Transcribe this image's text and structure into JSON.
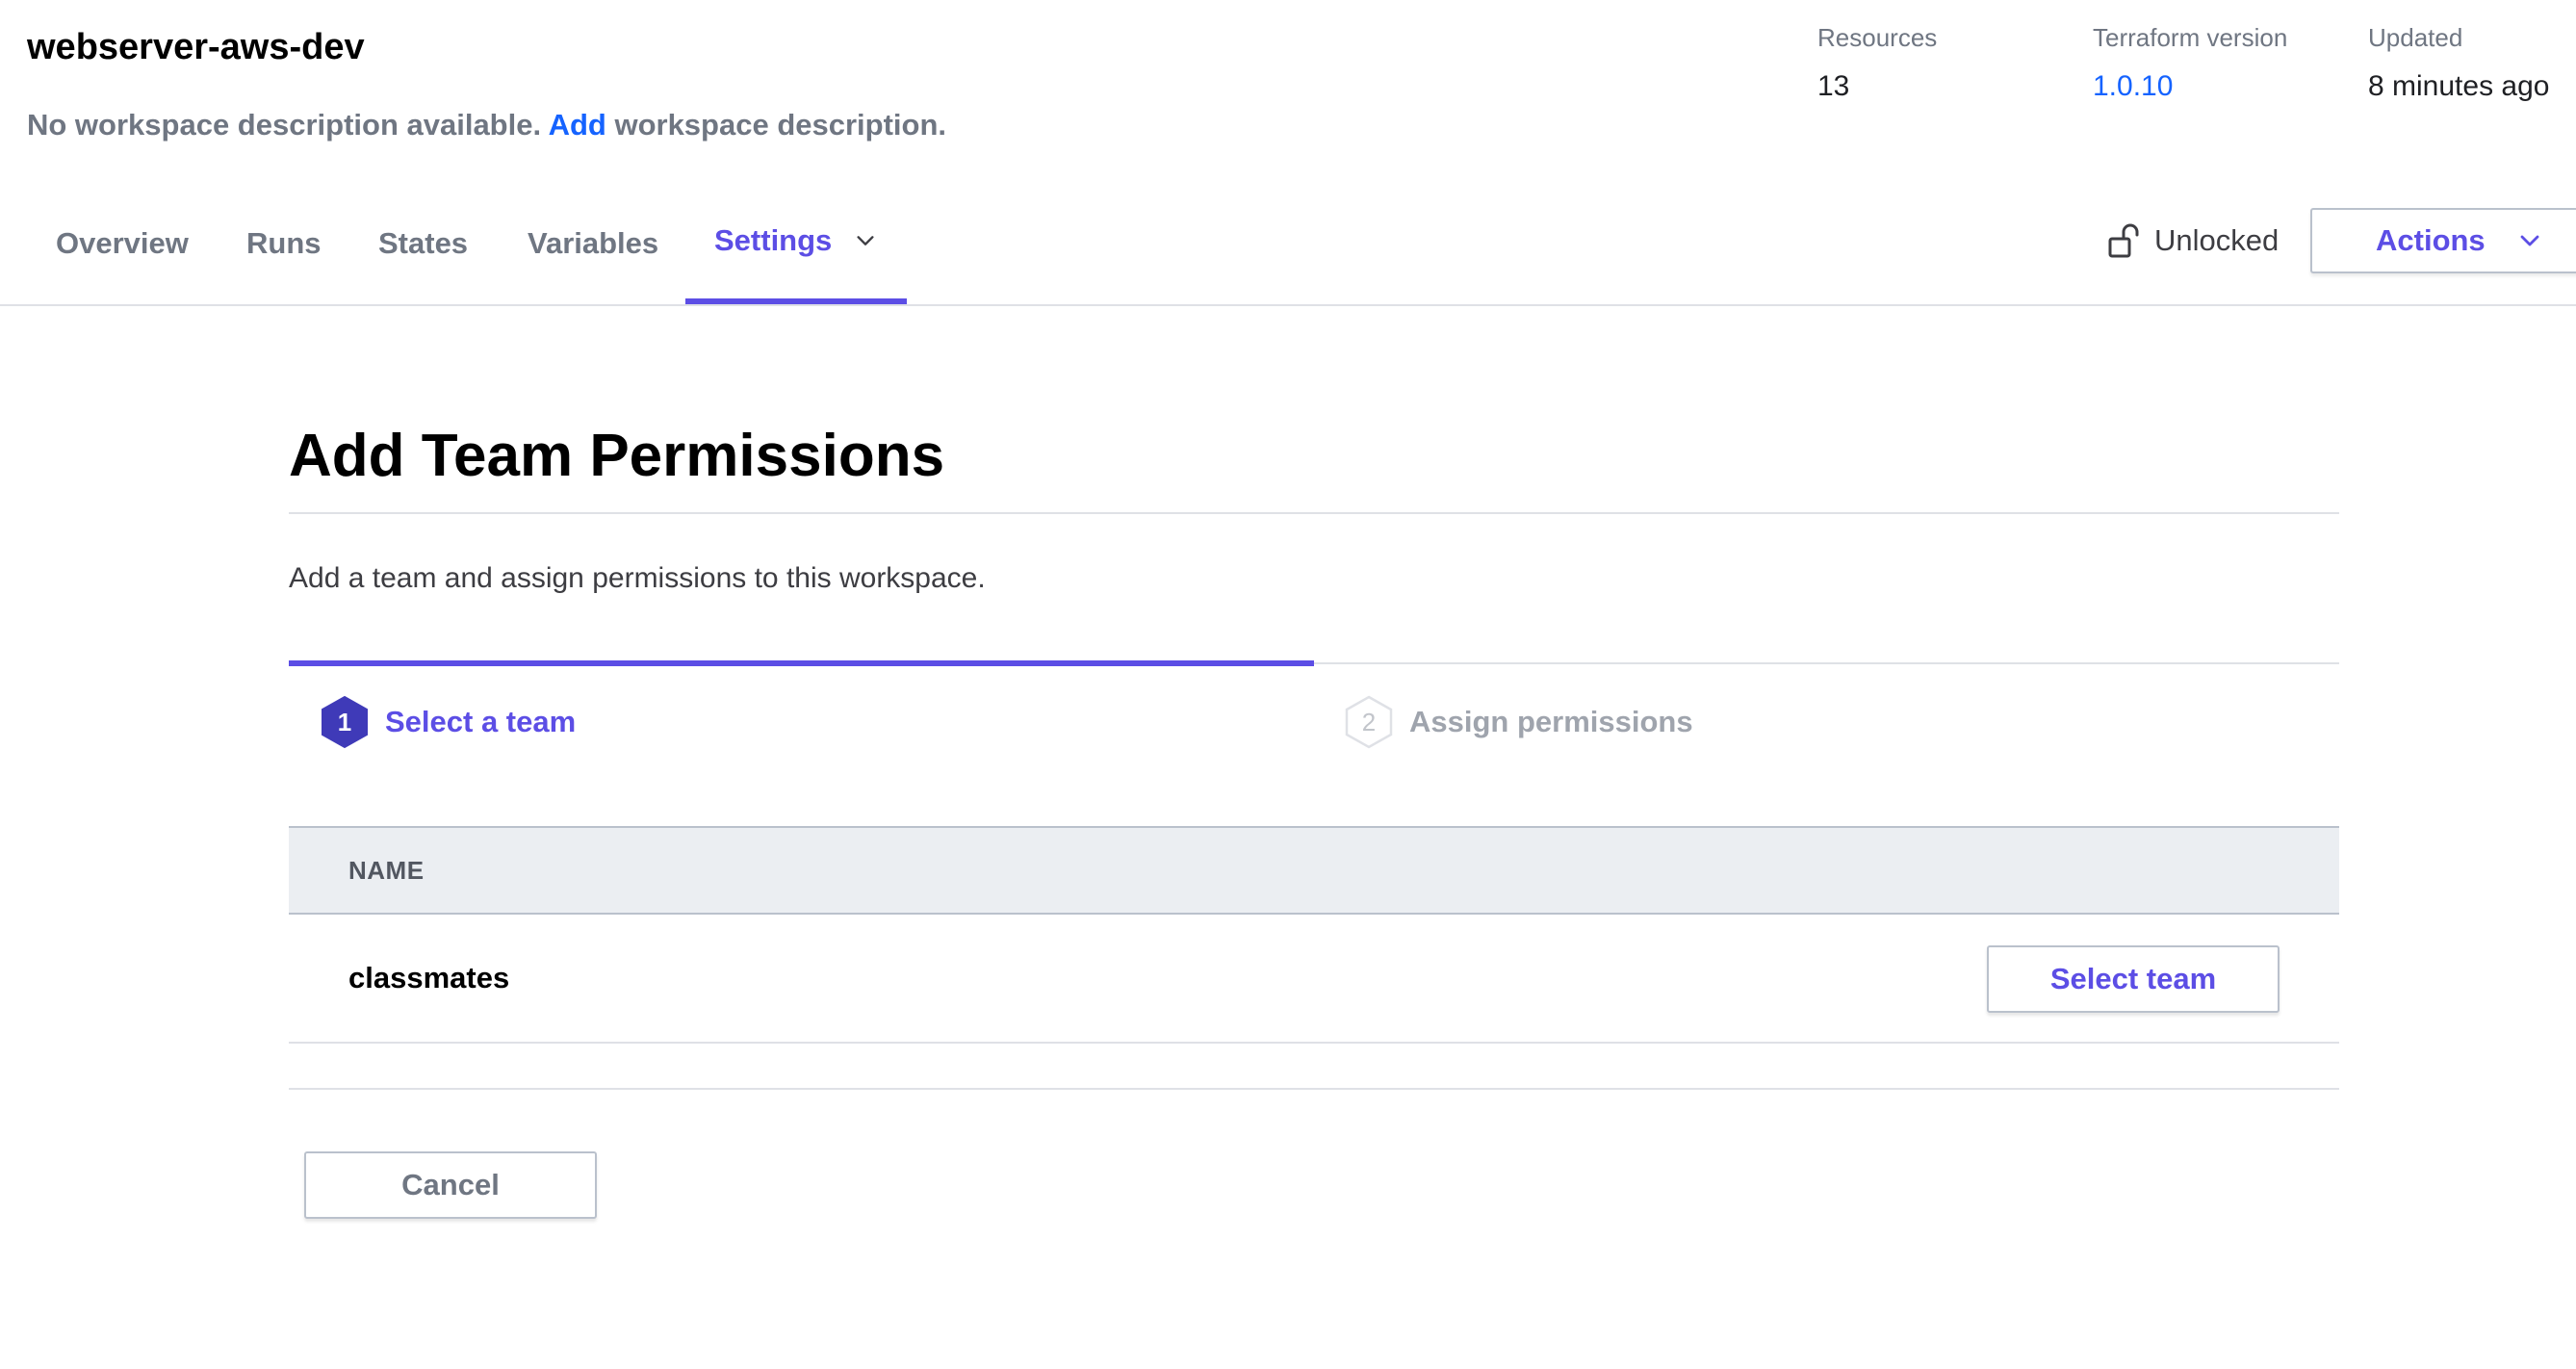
{
  "workspace": {
    "title": "webserver-aws-dev",
    "description_prefix": "No workspace description available.",
    "description_link": "Add",
    "description_suffix": "workspace description."
  },
  "meta": {
    "resources": {
      "label": "Resources",
      "value": "13"
    },
    "terraform_version": {
      "label": "Terraform version",
      "value": "1.0.10"
    },
    "updated": {
      "label": "Updated",
      "value": "8 minutes ago"
    }
  },
  "tabs": [
    {
      "label": "Overview",
      "active": false
    },
    {
      "label": "Runs",
      "active": false
    },
    {
      "label": "States",
      "active": false
    },
    {
      "label": "Variables",
      "active": false
    },
    {
      "label": "Settings",
      "active": true,
      "icon": "chevron-down-icon"
    }
  ],
  "lock_status": {
    "label": "Unlocked",
    "icon": "unlock-icon"
  },
  "actions_button": {
    "label": "Actions",
    "icon": "chevron-down-icon"
  },
  "page": {
    "title": "Add Team Permissions",
    "intro": "Add a team and assign permissions to this workspace."
  },
  "steps": [
    {
      "number": "1",
      "label": "Select a team",
      "active": true
    },
    {
      "number": "2",
      "label": "Assign permissions",
      "active": false
    }
  ],
  "steps_progress": 0.5,
  "table": {
    "columns": [
      "NAME"
    ],
    "rows": [
      {
        "name": "classmates",
        "action_label": "Select team"
      }
    ]
  },
  "cancel_button": {
    "label": "Cancel"
  },
  "colors": {
    "accent": "#5c4ee5",
    "link": "#1563ff",
    "muted_text": "#6f7682",
    "table_header_bg": "#ebeef2"
  }
}
